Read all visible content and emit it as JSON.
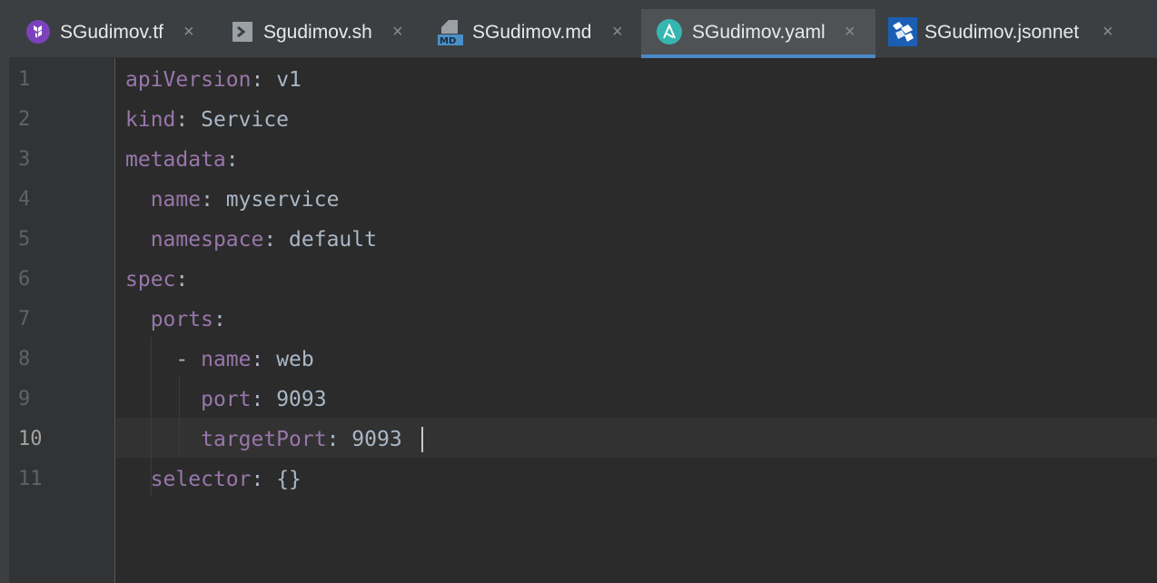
{
  "tabs": [
    {
      "label": "SGudimov.tf",
      "icon": "terraform-icon",
      "active": false
    },
    {
      "label": "Sgudimov.sh",
      "icon": "shell-script-icon",
      "active": false
    },
    {
      "label": "SGudimov.md",
      "icon": "markdown-icon",
      "active": false
    },
    {
      "label": "SGudimov.yaml",
      "icon": "ansible-icon",
      "active": true
    },
    {
      "label": "SGudimov.jsonnet",
      "icon": "jsonnet-icon",
      "active": false
    }
  ],
  "tab_close_glyph": "×",
  "editor": {
    "current_line": "10",
    "line_numbers": [
      "1",
      "2",
      "3",
      "4",
      "5",
      "6",
      "7",
      "8",
      "9",
      "10",
      "11"
    ],
    "lines": [
      {
        "indent": "",
        "dash": "",
        "key": "apiVersion",
        "colon": ":",
        "value": " v1"
      },
      {
        "indent": "",
        "dash": "",
        "key": "kind",
        "colon": ":",
        "value": " Service"
      },
      {
        "indent": "",
        "dash": "",
        "key": "metadata",
        "colon": ":",
        "value": ""
      },
      {
        "indent": "  ",
        "dash": "",
        "key": "name",
        "colon": ":",
        "value": " myservice"
      },
      {
        "indent": "  ",
        "dash": "",
        "key": "namespace",
        "colon": ":",
        "value": " default"
      },
      {
        "indent": "",
        "dash": "",
        "key": "spec",
        "colon": ":",
        "value": ""
      },
      {
        "indent": "  ",
        "dash": "",
        "key": "ports",
        "colon": ":",
        "value": ""
      },
      {
        "indent": "    ",
        "dash": "- ",
        "key": "name",
        "colon": ":",
        "value": " web"
      },
      {
        "indent": "      ",
        "dash": "",
        "key": "port",
        "colon": ":",
        "value": " 9093"
      },
      {
        "indent": "      ",
        "dash": "",
        "key": "targetPort",
        "colon": ":",
        "value": " 9093"
      },
      {
        "indent": "  ",
        "dash": "",
        "key": "selector",
        "colon": ":",
        "value": " {}"
      }
    ]
  },
  "colors": {
    "key": "#9876aa",
    "value": "#a9b7c6",
    "accent": "#4a88c7",
    "background": "#2b2b2b",
    "gutter": "#313335"
  }
}
